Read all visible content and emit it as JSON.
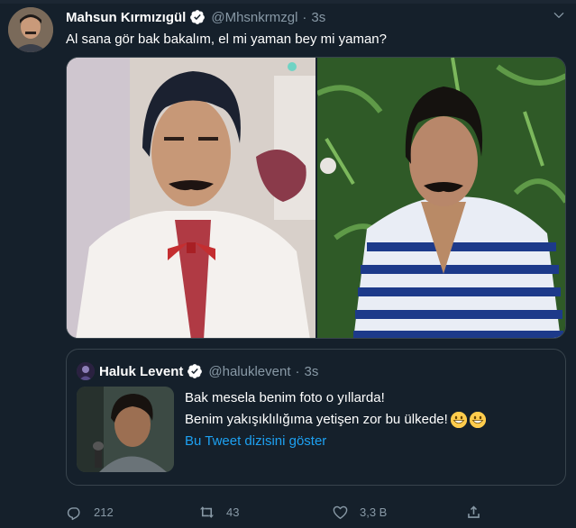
{
  "tweet": {
    "author_name": "Mahsun Kırmızıgül",
    "handle": "@Mhsnkrmzgl",
    "separator": "·",
    "time": "3s",
    "text": "Al sana gör bak bakalım, el mi yaman bey mi yaman?"
  },
  "quoted": {
    "author_name": "Haluk Levent",
    "handle": "@haluklevent",
    "separator": "·",
    "time": "3s",
    "line1": "Bak mesela benim foto o yıllarda!",
    "line2": "Benim yakışıklılığıma yetişen zor bu ülkede!",
    "link": "Bu Tweet dizisini göster"
  },
  "actions": {
    "reply_count": "212",
    "retweet_count": "43",
    "like_count": "3,3 B"
  },
  "colors": {
    "background": "#15202b",
    "secondary_text": "#8899a6",
    "link": "#1da1f2",
    "border": "#38444d"
  },
  "icons": [
    "verified-icon",
    "chevron-down-icon",
    "reply-icon",
    "retweet-icon",
    "like-icon",
    "share-icon",
    "grinning-emoji"
  ]
}
